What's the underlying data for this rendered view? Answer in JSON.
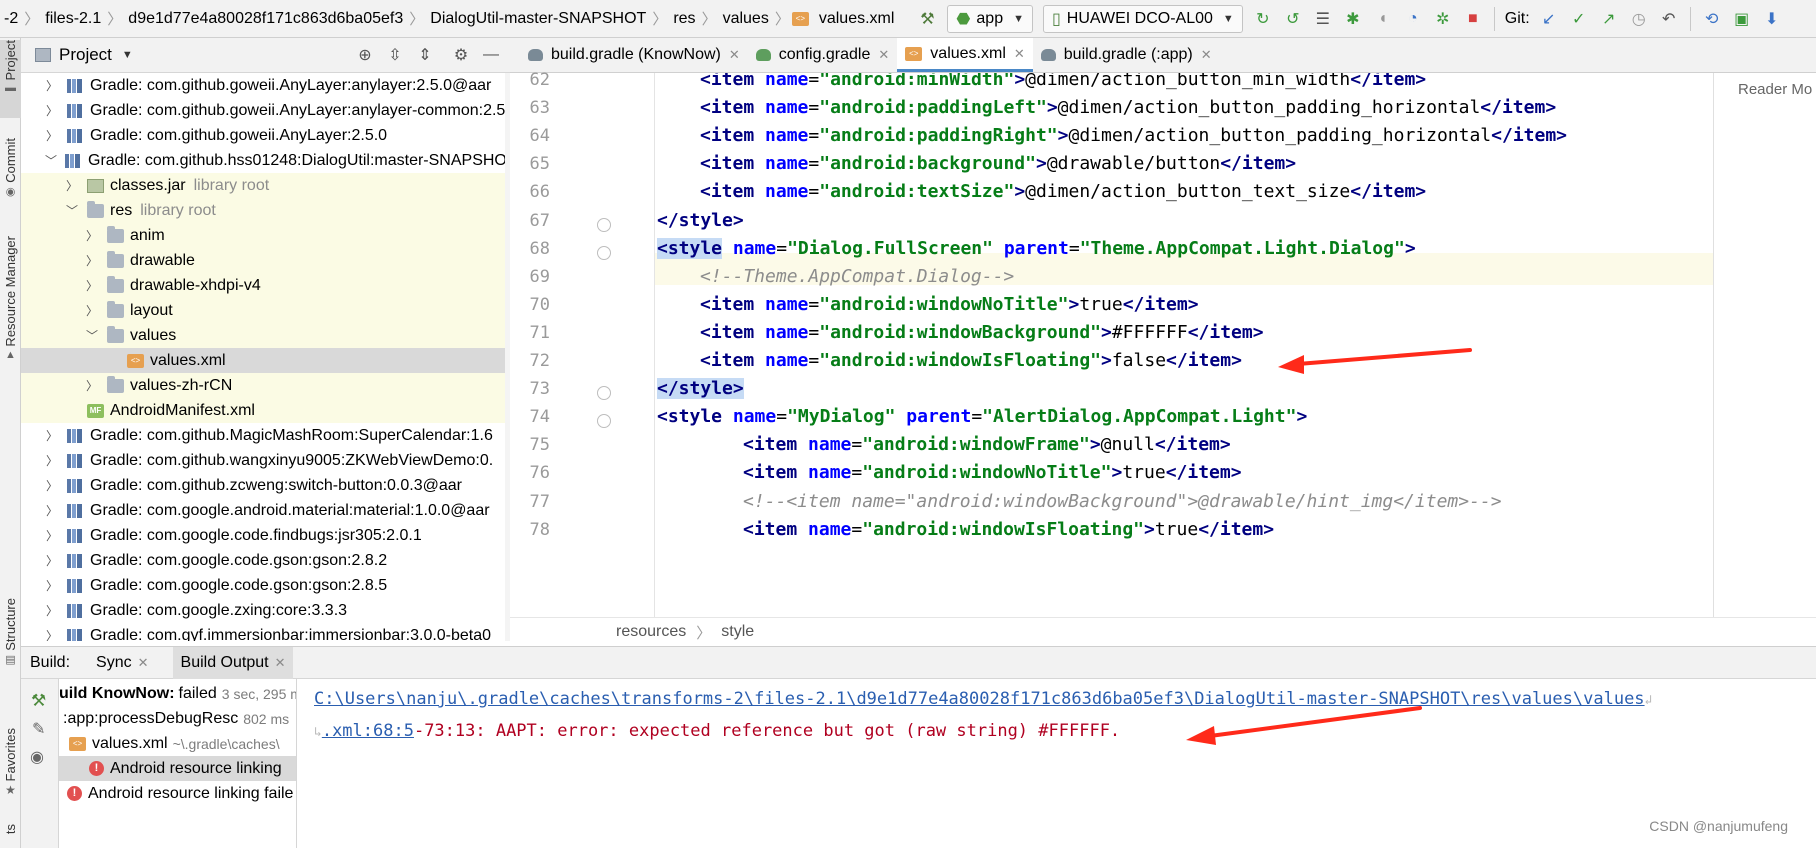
{
  "navbar": {
    "crumbs": [
      "-2",
      "files-2.1",
      "d9e1d77e4a80028f171c863d6ba05ef3",
      "DialogUtil-master-SNAPSHOT",
      "res",
      "values",
      "values.xml"
    ],
    "run_config": "app",
    "device": "HUAWEI DCO-AL00",
    "git_label": "Git:"
  },
  "left_strip": {
    "project": "Project",
    "commit": "Commit",
    "resource_manager": "Resource Manager",
    "structure": "Structure",
    "favorites": "Favorites",
    "build_variants": "ts"
  },
  "project_panel": {
    "title": "Project",
    "rows": [
      {
        "label": "Gradle: com.github.goweii.AnyLayer:anylayer:2.5.0@aar",
        "hint": "",
        "icon": "library-icon",
        "depth": 1,
        "expand": "collapsed",
        "style": ""
      },
      {
        "label": "Gradle: com.github.goweii.AnyLayer:anylayer-common:2.5",
        "hint": "",
        "icon": "library-icon",
        "depth": 1,
        "expand": "collapsed",
        "style": ""
      },
      {
        "label": "Gradle: com.github.goweii.AnyLayer:2.5.0",
        "hint": "",
        "icon": "library-icon",
        "depth": 1,
        "expand": "collapsed",
        "style": ""
      },
      {
        "label": "Gradle: com.github.hss01248:DialogUtil:master-SNAPSHOT",
        "hint": "",
        "icon": "library-icon",
        "depth": 1,
        "expand": "expanded",
        "style": ""
      },
      {
        "label": "classes.jar",
        "hint": "library root",
        "icon": "jar-icon",
        "depth": 2,
        "expand": "collapsed",
        "style": "yel"
      },
      {
        "label": "res",
        "hint": "library root",
        "icon": "folder-icon",
        "depth": 2,
        "expand": "expanded",
        "style": "yel"
      },
      {
        "label": "anim",
        "hint": "",
        "icon": "folder-icon",
        "depth": 3,
        "expand": "collapsed",
        "style": "yel"
      },
      {
        "label": "drawable",
        "hint": "",
        "icon": "folder-icon",
        "depth": 3,
        "expand": "collapsed",
        "style": "yel"
      },
      {
        "label": "drawable-xhdpi-v4",
        "hint": "",
        "icon": "folder-icon",
        "depth": 3,
        "expand": "collapsed",
        "style": "yel"
      },
      {
        "label": "layout",
        "hint": "",
        "icon": "folder-icon",
        "depth": 3,
        "expand": "collapsed",
        "style": "yel"
      },
      {
        "label": "values",
        "hint": "",
        "icon": "folder-icon",
        "depth": 3,
        "expand": "expanded",
        "style": "yel"
      },
      {
        "label": "values.xml",
        "hint": "",
        "icon": "xml-file-icon",
        "depth": 4,
        "expand": "none",
        "style": "sel"
      },
      {
        "label": "values-zh-rCN",
        "hint": "",
        "icon": "folder-icon",
        "depth": 3,
        "expand": "collapsed",
        "style": "yel"
      },
      {
        "label": "AndroidManifest.xml",
        "hint": "",
        "icon": "manifest-icon",
        "depth": 2,
        "expand": "none",
        "style": "yel"
      },
      {
        "label": "Gradle: com.github.MagicMashRoom:SuperCalendar:1.6",
        "hint": "",
        "icon": "library-icon",
        "depth": 1,
        "expand": "collapsed",
        "style": ""
      },
      {
        "label": "Gradle: com.github.wangxinyu9005:ZKWebViewDemo:0.",
        "hint": "",
        "icon": "library-icon",
        "depth": 1,
        "expand": "collapsed",
        "style": ""
      },
      {
        "label": "Gradle: com.github.zcweng:switch-button:0.0.3@aar",
        "hint": "",
        "icon": "library-icon",
        "depth": 1,
        "expand": "collapsed",
        "style": ""
      },
      {
        "label": "Gradle: com.google.android.material:material:1.0.0@aar",
        "hint": "",
        "icon": "library-icon",
        "depth": 1,
        "expand": "collapsed",
        "style": ""
      },
      {
        "label": "Gradle: com.google.code.findbugs:jsr305:2.0.1",
        "hint": "",
        "icon": "library-icon",
        "depth": 1,
        "expand": "collapsed",
        "style": ""
      },
      {
        "label": "Gradle: com.google.code.gson:gson:2.8.2",
        "hint": "",
        "icon": "library-icon",
        "depth": 1,
        "expand": "collapsed",
        "style": ""
      },
      {
        "label": "Gradle: com.google.code.gson:gson:2.8.5",
        "hint": "",
        "icon": "library-icon",
        "depth": 1,
        "expand": "collapsed",
        "style": ""
      },
      {
        "label": "Gradle: com.google.zxing:core:3.3.3",
        "hint": "",
        "icon": "library-icon",
        "depth": 1,
        "expand": "collapsed",
        "style": ""
      },
      {
        "label": "Gradle: com.gyf.immersionbar:immersionbar:3.0.0-beta0",
        "hint": "",
        "icon": "library-icon",
        "depth": 1,
        "expand": "collapsed",
        "style": ""
      }
    ]
  },
  "tabs": [
    {
      "label": "build.gradle (KnowNow)",
      "icon": "gradle-icon",
      "active": false
    },
    {
      "label": "config.gradle",
      "icon": "config-gradle-icon",
      "active": false
    },
    {
      "label": "values.xml",
      "icon": "xml-file-icon",
      "active": true
    },
    {
      "label": "build.gradle (:app)",
      "icon": "gradle-icon",
      "active": false
    }
  ],
  "editor": {
    "lines": [
      {
        "num": "62",
        "code": "<item name=\"android:minWidth\">@dimen/action_button_min_width</item>",
        "indent": 1
      },
      {
        "num": "63",
        "code": "<item name=\"android:paddingLeft\">@dimen/action_button_padding_horizontal</item>",
        "indent": 1
      },
      {
        "num": "64",
        "code": "<item name=\"android:paddingRight\">@dimen/action_button_padding_horizontal</item>",
        "indent": 1
      },
      {
        "num": "65",
        "code": "<item name=\"android:background\">@drawable/button</item>",
        "indent": 1
      },
      {
        "num": "66",
        "code": "<item name=\"android:textSize\">@dimen/action_button_text_size</item>",
        "indent": 1
      },
      {
        "num": "67",
        "code": "</style>",
        "indent": 0
      },
      {
        "num": "68",
        "code": "<style name=\"Dialog.FullScreen\" parent=\"Theme.AppCompat.Light.Dialog\">",
        "indent": 0
      },
      {
        "num": "69",
        "code": "<!--Theme.AppCompat.Dialog-->",
        "indent": 1
      },
      {
        "num": "70",
        "code": "<item name=\"android:windowNoTitle\">true</item>",
        "indent": 1
      },
      {
        "num": "71",
        "code": "<item name=\"android:windowBackground\">#FFFFFF</item>",
        "indent": 1
      },
      {
        "num": "72",
        "code": "<item name=\"android:windowIsFloating\">false</item>",
        "indent": 1
      },
      {
        "num": "73",
        "code": "</style>",
        "indent": 0
      },
      {
        "num": "74",
        "code": "<style name=\"MyDialog\" parent=\"AlertDialog.AppCompat.Light\">",
        "indent": 0
      },
      {
        "num": "75",
        "code": "<item name=\"android:windowFrame\">@null</item>",
        "indent": 2
      },
      {
        "num": "76",
        "code": "<item name=\"android:windowNoTitle\">true</item>",
        "indent": 2
      },
      {
        "num": "77",
        "code": "<!--<item name=\"android:windowBackground\">@drawable/hint_img</item>-->",
        "indent": 2
      },
      {
        "num": "78",
        "code": "<item name=\"android:windowIsFloating\">true</item>",
        "indent": 2
      }
    ],
    "breadcrumb": [
      "resources",
      "style"
    ],
    "reader_mode": "Reader Mo"
  },
  "build": {
    "label": "Build:",
    "tabs": [
      "Sync",
      "Build Output"
    ],
    "tree": [
      {
        "text": "uild KnowNow:",
        "suffix": "failed",
        "time": "3 sec, 295 ms",
        "kind": "root"
      },
      {
        "text": ":app:processDebugResc",
        "suffix": "",
        "time": "802 ms",
        "kind": "task"
      },
      {
        "text": "values.xml",
        "suffix": "",
        "time": "~\\.gradle\\caches\\",
        "kind": "file"
      },
      {
        "text": "Android resource linking",
        "suffix": "",
        "time": "",
        "kind": "error-selected"
      },
      {
        "text": "Android resource linking faile",
        "suffix": "",
        "time": "",
        "kind": "error"
      }
    ],
    "output_path": "C:\\Users\\nanju\\.gradle\\caches\\transforms-2\\files-2.1\\d9e1d77e4a80028f171c863d6ba05ef3\\DialogUtil-master-SNAPSHOT\\res\\values\\values",
    "output_loc": ".xml:68:5",
    "output_msg": "-73:13: AAPT: error: expected reference but got (raw string) #FFFFFF."
  },
  "watermark": "CSDN @nanjumufeng",
  "colors": {
    "accent": "#4a88c7",
    "error": "#b00020",
    "arrow": "#ff2a1a"
  }
}
